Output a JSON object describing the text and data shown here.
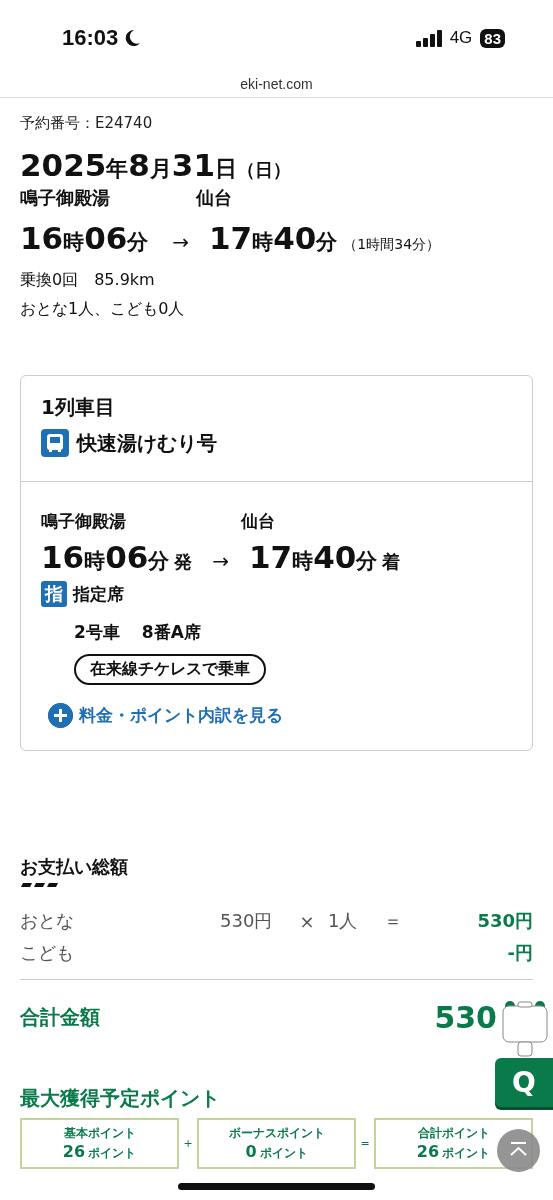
{
  "status_bar": {
    "time": "16:03",
    "network": "4G",
    "battery": "83"
  },
  "url": "eki-net.com",
  "summary": {
    "reservation": "予約番号：E24740",
    "date": "2025年8月31日",
    "weekday": "（日）",
    "from": "鳴子御殿湯",
    "to": "仙台",
    "depart": "16時06分",
    "arrow": "→",
    "arrive": "17時40分",
    "duration": "（1時間34分）",
    "transfers": "乗換0回　85.9km",
    "passengers": "おとな1人、こども0人"
  },
  "train": {
    "title": "1列車目",
    "name": "快速湯けむり号",
    "from": "鳴子御殿湯",
    "to": "仙台",
    "depart": "16時06分",
    "depart_suffix": "発",
    "arrow": "→",
    "arrive": "17時40分",
    "arrive_suffix": "着",
    "seat_badge": "指",
    "seat_type": "指定席",
    "car": "2号車",
    "seat": "8番A席",
    "ticketless": "在来線チケレスで乗車",
    "details_link": "料金・ポイント内訳を見る"
  },
  "payment": {
    "title": "お支払い総額",
    "rows": [
      {
        "label": "おとな",
        "unit_price": "530円",
        "times": "×",
        "count": "1人",
        "equals": "＝",
        "amount": "530円"
      },
      {
        "label": "こども",
        "amount": "-円"
      }
    ],
    "total_label": "合計金額",
    "total": "530"
  },
  "points": {
    "title": "最大獲得予定ポイント",
    "boxes": [
      {
        "label": "基本ポイント",
        "value": "26",
        "unit": "ポイント"
      },
      {
        "label": "ボーナスポイント",
        "value": "0",
        "unit": "ポイント"
      },
      {
        "label": "合計ポイント",
        "value": "26",
        "unit": "ポイント"
      }
    ],
    "operators": [
      "+",
      "="
    ]
  },
  "help_button": "Q"
}
